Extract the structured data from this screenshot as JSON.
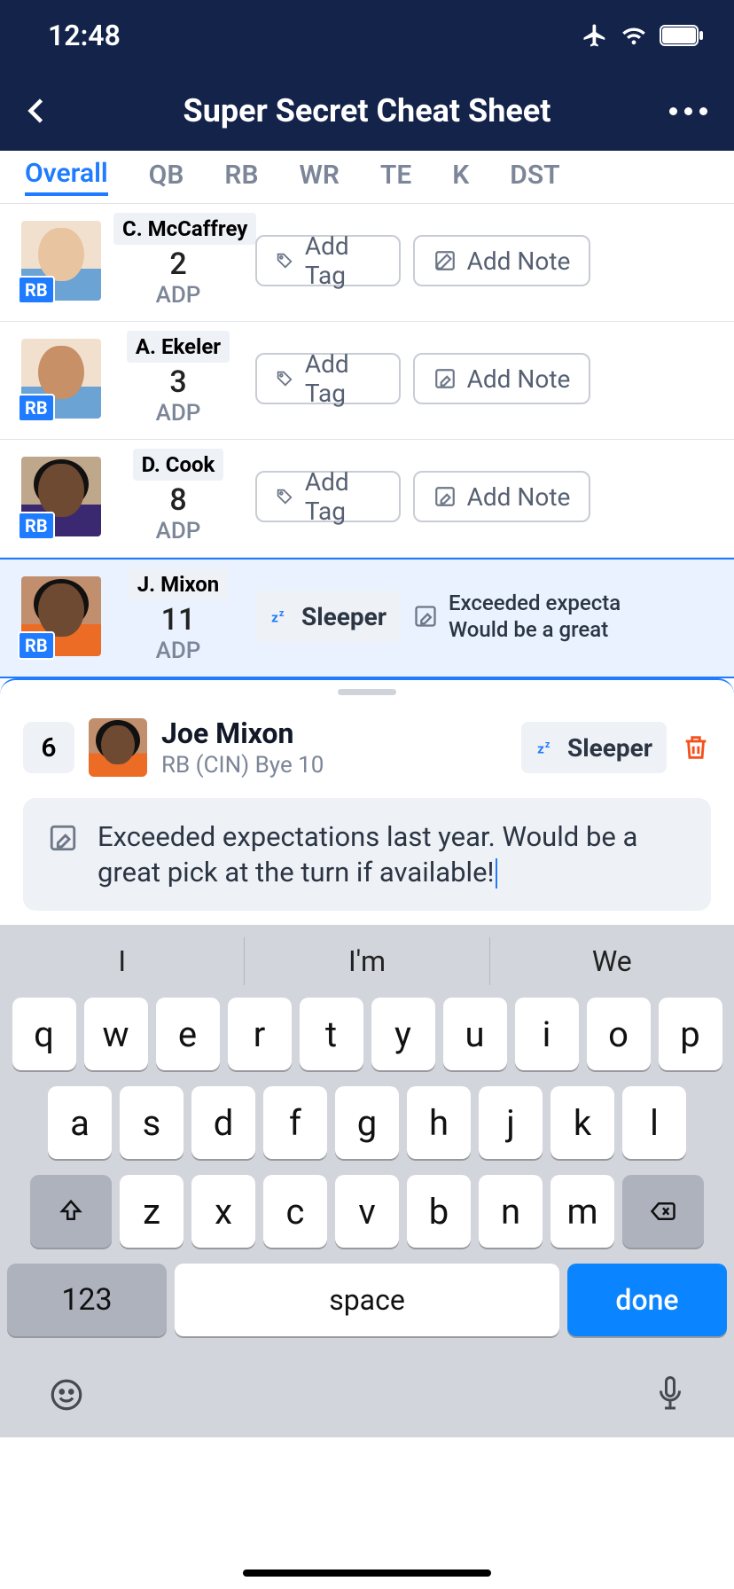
{
  "status": {
    "time": "12:48"
  },
  "nav": {
    "title": "Super Secret Cheat Sheet"
  },
  "tabs": [
    "Overall",
    "QB",
    "RB",
    "WR",
    "TE",
    "K",
    "DST"
  ],
  "add_tag_label": "Add Tag",
  "add_note_label": "Add Note",
  "adp_label": "ADP",
  "pos_label": "RB",
  "sleeper_label": "Sleeper",
  "players": [
    {
      "name": "C. McCaffrey",
      "adp": "2"
    },
    {
      "name": "A. Ekeler",
      "adp": "3"
    },
    {
      "name": "D. Cook",
      "adp": "8"
    },
    {
      "name": "J. Mixon",
      "adp": "11",
      "note_preview_l1": "Exceeded expecta",
      "note_preview_l2": "Would be a great "
    }
  ],
  "sheet": {
    "rank": "6",
    "name": "Joe Mixon",
    "meta": "RB (CIN) Bye 10",
    "note": "Exceeded expectations last year. Would be a great pick at the turn if available!"
  },
  "keyboard": {
    "suggestions": [
      "I",
      "I'm",
      "We"
    ],
    "row1": [
      "q",
      "w",
      "e",
      "r",
      "t",
      "y",
      "u",
      "i",
      "o",
      "p"
    ],
    "row2": [
      "a",
      "s",
      "d",
      "f",
      "g",
      "h",
      "j",
      "k",
      "l"
    ],
    "row3": [
      "z",
      "x",
      "c",
      "v",
      "b",
      "n",
      "m"
    ],
    "num_label": "123",
    "space_label": "space",
    "done_label": "done"
  }
}
